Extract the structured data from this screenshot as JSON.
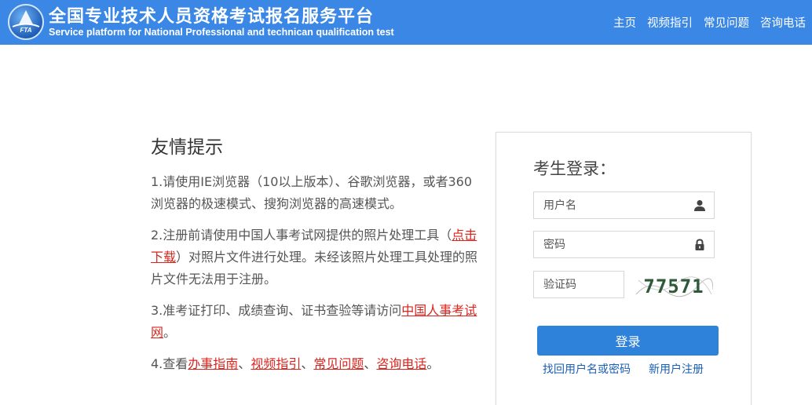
{
  "header": {
    "logo_text": "FTA",
    "title_cn": "全国专业技术人员资格考试报名服务平台",
    "title_en": "Service platform for National Professional and technican qualification test",
    "nav": [
      "主页",
      "视频指引",
      "常见问题",
      "咨询电话"
    ]
  },
  "tips": {
    "title": "友情提示",
    "tip1": "1.请使用IE浏览器（10以上版本）、谷歌浏览器，或者360浏览器的极速模式、搜狗浏览器的高速模式。",
    "tip2_a": "2.注册前请使用中国人事考试网提供的照片处理工具（",
    "tip2_link": "点击下载",
    "tip2_b": "）对照片文件进行处理。未经该照片处理工具处理的照片文件无法用于注册。",
    "tip3_a": "3.准考证打印、成绩查询、证书查验等请访问",
    "tip3_link": "中国人事考试网",
    "tip3_b": "。",
    "tip4_a": "4.查看",
    "tip4_links": [
      "办事指南",
      "视频指引",
      "常见问题",
      "咨询电话"
    ],
    "tip4_sep": "、",
    "tip4_end": "。"
  },
  "login": {
    "title": "考生登录：",
    "username_placeholder": "用户名",
    "password_placeholder": "密码",
    "captcha_placeholder": "验证码",
    "captcha_text": "77571",
    "submit_label": "登录",
    "recover_link": "找回用户名或密码",
    "register_link": "新用户注册"
  },
  "colors": {
    "header_bg": "#3a87e6",
    "button_bg": "#2f82d9",
    "link_red": "#d8261f",
    "link_blue": "#1a5fb4"
  }
}
